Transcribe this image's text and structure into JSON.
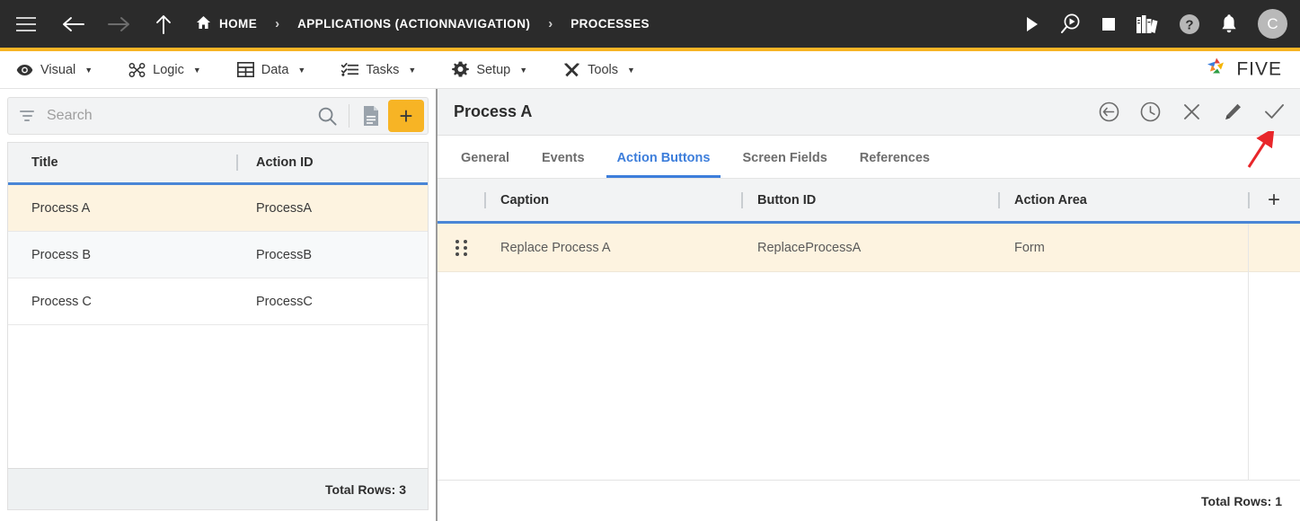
{
  "topbar": {
    "menu_icon": "hamburger-icon",
    "back_icon": "arrow-left-icon",
    "forward_icon": "arrow-right-icon",
    "up_icon": "arrow-up-icon",
    "breadcrumbs": [
      {
        "label": "HOME",
        "icon": "home-icon"
      },
      {
        "label": "APPLICATIONS (ACTIONNAVIGATION)",
        "icon": ""
      },
      {
        "label": "PROCESSES",
        "icon": ""
      }
    ],
    "separator": "›",
    "actions": [
      {
        "name": "run-icon",
        "glyph": "▶"
      },
      {
        "name": "debug-icon",
        "glyph": ""
      },
      {
        "name": "stop-icon",
        "glyph": "■"
      },
      {
        "name": "library-icon",
        "glyph": ""
      },
      {
        "name": "help-icon",
        "glyph": "?"
      },
      {
        "name": "notifications-bell-icon",
        "glyph": "🔔"
      }
    ],
    "avatar_initial": "C",
    "background": "#2b2b2b",
    "accent_rule": "#f7b425"
  },
  "menubar": {
    "items": [
      {
        "label": "Visual",
        "icon": "eye-icon"
      },
      {
        "label": "Logic",
        "icon": "flow-icon"
      },
      {
        "label": "Data",
        "icon": "table-icon"
      },
      {
        "label": "Tasks",
        "icon": "checklist-icon"
      },
      {
        "label": "Setup",
        "icon": "gear-icon"
      },
      {
        "label": "Tools",
        "icon": "tools-icon"
      }
    ],
    "caret": "▼",
    "logo_text": "FIVE"
  },
  "left_panel": {
    "search": {
      "placeholder": "Search",
      "value": "",
      "filter_icon": "filter-icon",
      "search_icon": "search-icon",
      "document_icon": "document-icon",
      "add_label": "+",
      "add_color": "#f7b425"
    },
    "grid": {
      "columns": [
        "Title",
        "Action ID"
      ],
      "rows": [
        {
          "title": "Process A",
          "action_id": "ProcessA",
          "selected": true
        },
        {
          "title": "Process B",
          "action_id": "ProcessB",
          "selected": false
        },
        {
          "title": "Process C",
          "action_id": "ProcessC",
          "selected": false
        }
      ],
      "footer": "Total Rows: 3"
    }
  },
  "right_panel": {
    "title": "Process A",
    "actions": [
      {
        "name": "back-circle-icon"
      },
      {
        "name": "history-clock-icon"
      },
      {
        "name": "close-icon"
      },
      {
        "name": "edit-pencil-icon"
      },
      {
        "name": "confirm-check-icon"
      }
    ],
    "tabs": [
      {
        "label": "General",
        "active": false
      },
      {
        "label": "Events",
        "active": false
      },
      {
        "label": "Action Buttons",
        "active": true
      },
      {
        "label": "Screen Fields",
        "active": false
      },
      {
        "label": "References",
        "active": false
      }
    ],
    "active_tab_color": "#3d7edb",
    "grid": {
      "columns": [
        "Caption",
        "Button ID",
        "Action Area"
      ],
      "add_label": "+",
      "rows": [
        {
          "drag_handle": "drag-handle-icon",
          "caption": "Replace Process A",
          "button_id": "ReplaceProcessA",
          "action_area": "Form",
          "selected": true
        }
      ],
      "footer": "Total Rows: 1"
    }
  },
  "annotation": {
    "arrow_color": "#e8262a",
    "points_to": "confirm-check-icon"
  }
}
